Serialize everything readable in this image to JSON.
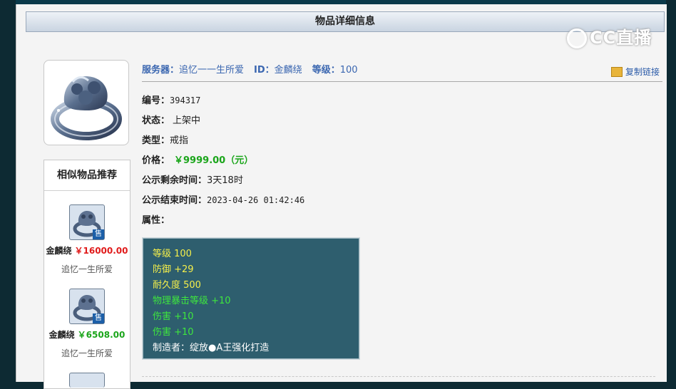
{
  "page": {
    "title": "物品详细信息",
    "watermark": "CC直播"
  },
  "header": {
    "server_label": "服务器：",
    "server_value": "追忆一一生所爱",
    "id_label": "ID：",
    "id_value": "金麟绕",
    "level_label": "等级：",
    "level_value": "100",
    "copy_link": "复制链接"
  },
  "details": {
    "number_label": "编号：",
    "number_value": "394317",
    "status_label": "状态：",
    "status_value": "上架中",
    "type_label": "类型：",
    "type_value": "戒指",
    "price_label": "价格：",
    "price_value": "￥9999.00（元）",
    "remaining_label": "公示剩余时间：",
    "remaining_value": "3天18时",
    "end_label": "公示结束时间：",
    "end_value": "2023-04-26 01:42:46",
    "attr_label": "属性："
  },
  "attributes": [
    {
      "text": "等级  100",
      "color": "#f5ef4a"
    },
    {
      "text": "防御  +29",
      "color": "#f5ef4a"
    },
    {
      "text": "耐久度  500",
      "color": "#f5ef4a"
    },
    {
      "text": "物理暴击等级  +10",
      "color": "#3ee63e"
    },
    {
      "text": "伤害  +10",
      "color": "#3ee63e"
    },
    {
      "text": "伤害  +10",
      "color": "#3ee63e"
    },
    {
      "text": "制造者：绽放●A王强化打造",
      "color": "#ffffff"
    }
  ],
  "similar": {
    "title": "相似物品推荐",
    "badge": "售",
    "items": [
      {
        "name": "金麟绕",
        "price": "￥16000.00",
        "price_color": "#e01b1b",
        "server": "追忆一生所爱"
      },
      {
        "name": "金麟绕",
        "price": "￥6508.00",
        "price_color": "#1aa51a",
        "server": "追忆一生所爱"
      }
    ]
  },
  "colors": {
    "accent_blue": "#3a66b0",
    "price_green": "#1aa51a",
    "attr_bg": "#2e5e6e"
  }
}
